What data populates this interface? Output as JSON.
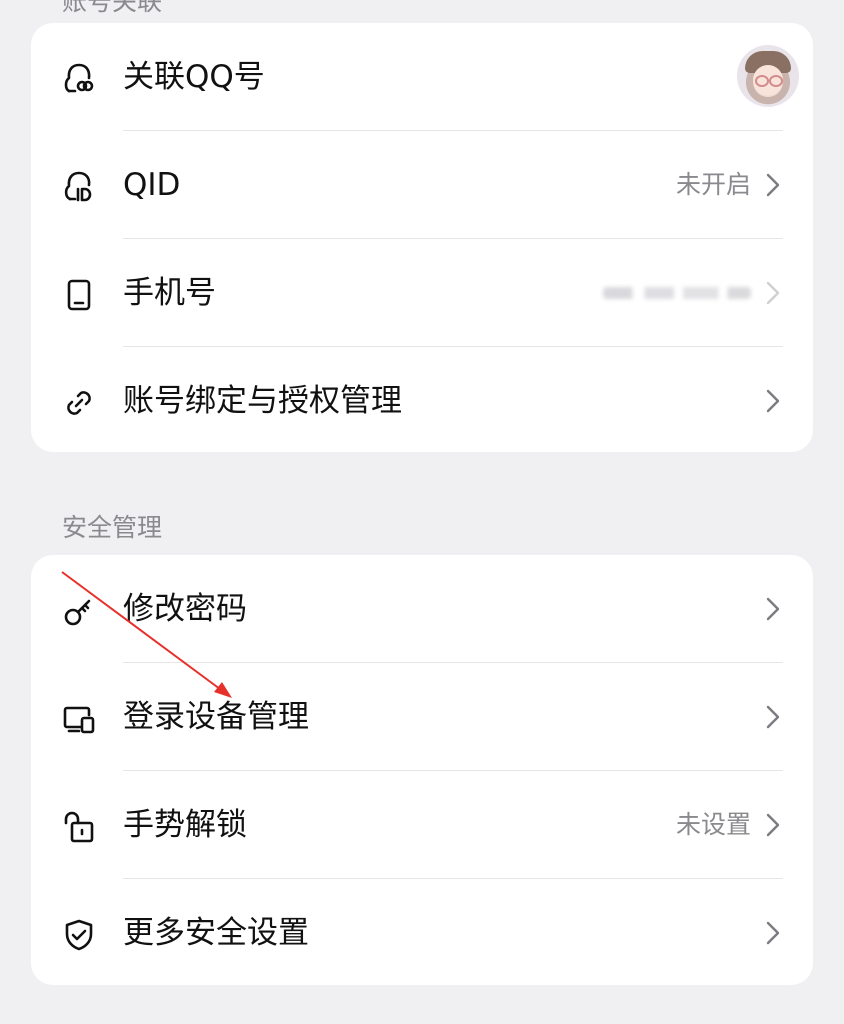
{
  "account_section": {
    "header": "账号关联",
    "items": [
      {
        "label": "关联QQ号",
        "icon": "qq-link-icon",
        "value": "",
        "chevron": false
      },
      {
        "label": "QID",
        "icon": "qid-icon",
        "value": "未开启",
        "chevron": true
      },
      {
        "label": "手机号",
        "icon": "phone-icon",
        "value": "",
        "chevron": true
      },
      {
        "label": "账号绑定与授权管理",
        "icon": "link-icon",
        "value": "",
        "chevron": true
      }
    ]
  },
  "security_section": {
    "header": "安全管理",
    "items": [
      {
        "label": "修改密码",
        "icon": "key-icon",
        "value": "",
        "chevron": true
      },
      {
        "label": "登录设备管理",
        "icon": "devices-icon",
        "value": "",
        "chevron": true
      },
      {
        "label": "手势解锁",
        "icon": "unlock-icon",
        "value": "未设置",
        "chevron": true
      },
      {
        "label": "更多安全设置",
        "icon": "shield-check-icon",
        "value": "",
        "chevron": true
      }
    ]
  },
  "colors": {
    "annotation_arrow": "#e8302a",
    "background": "#f0f0f2",
    "card": "#ffffff"
  }
}
